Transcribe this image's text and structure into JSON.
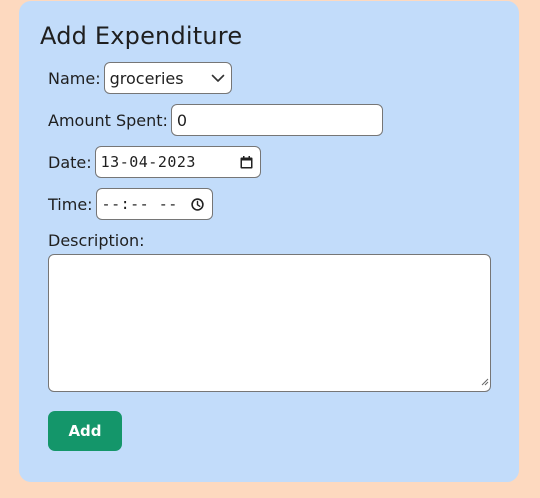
{
  "form": {
    "title": "Add Expenditure",
    "name_label": "Name:",
    "name_value": "groceries",
    "amount_label": "Amount Spent:",
    "amount_value": "0",
    "date_label": "Date:",
    "date_value": "13-04-2023",
    "time_label": "Time:",
    "time_value": "--:-- --",
    "description_label": "Description:",
    "description_value": "",
    "add_label": "Add"
  },
  "colors": {
    "page_bg": "#fdd9bf",
    "card_bg": "#c2dcfa",
    "button_bg": "#14966a"
  },
  "icons": {
    "select": "chevron-down-icon",
    "date": "calendar-icon",
    "time": "clock-icon"
  }
}
